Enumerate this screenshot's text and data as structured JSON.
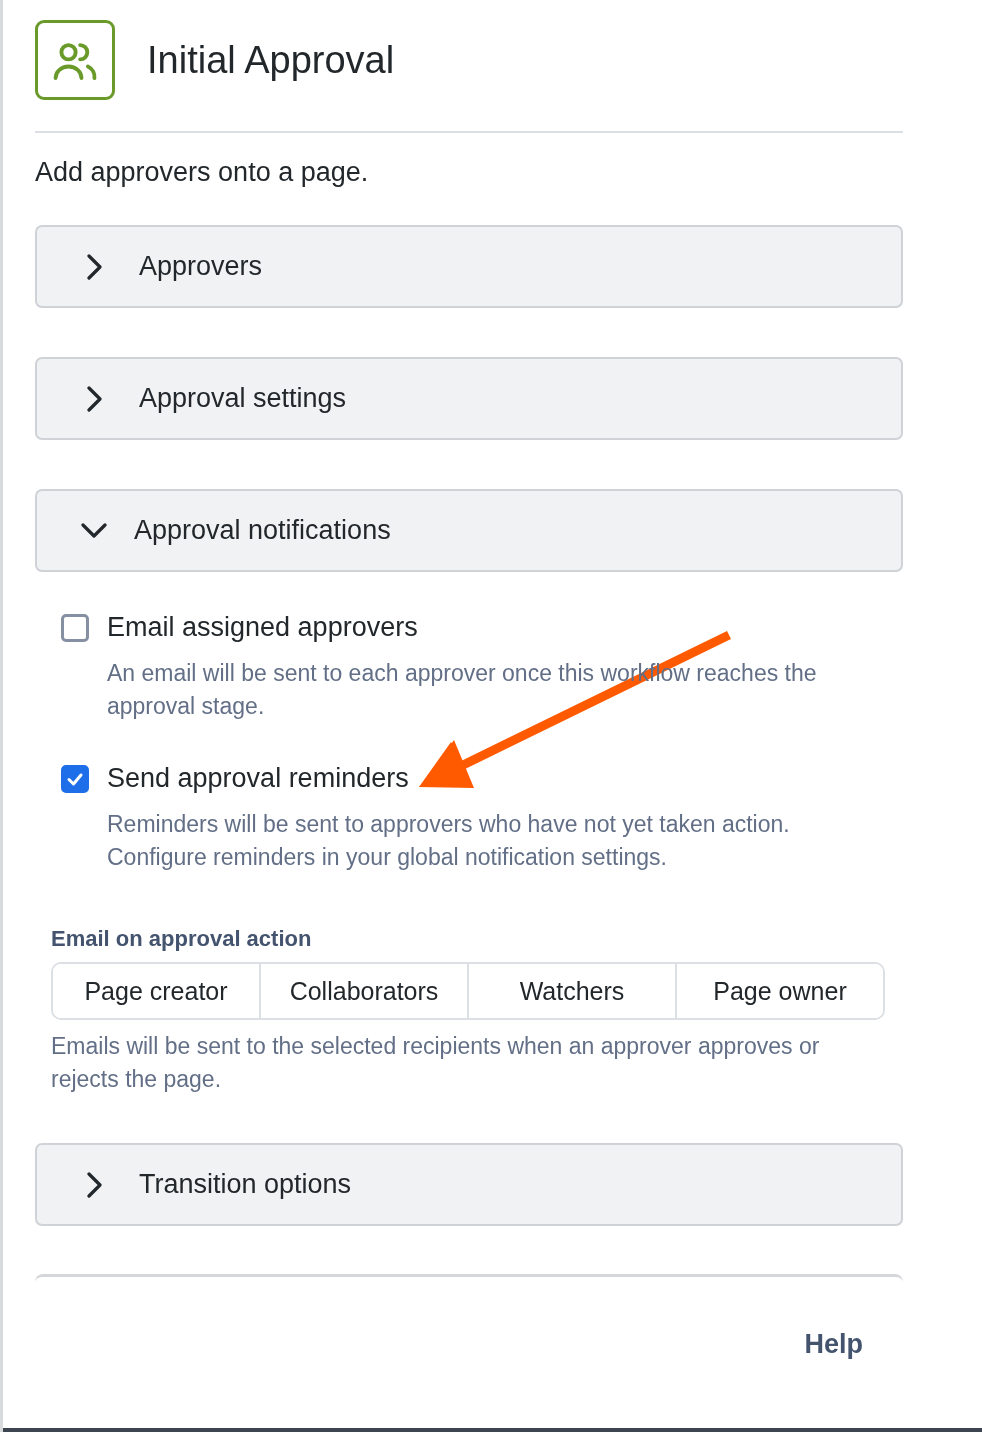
{
  "header": {
    "title": "Initial Approval",
    "description": "Add approvers onto a page."
  },
  "sections": [
    {
      "title": "Approvers",
      "expanded": false
    },
    {
      "title": "Approval settings",
      "expanded": false
    },
    {
      "title": "Approval notifications",
      "expanded": true,
      "options": [
        {
          "label": "Email assigned approvers",
          "checked": false,
          "description": "An email will be sent to each approver once this workflow reaches the approval stage."
        },
        {
          "label": "Send approval reminders",
          "checked": true,
          "description": "Reminders will be sent to approvers who have not yet taken action. Configure reminders in your global notification settings."
        }
      ],
      "recipients": {
        "label": "Email on approval action",
        "buttons": [
          {
            "label": "Page creator",
            "selected": false
          },
          {
            "label": "Collaborators",
            "selected": false
          },
          {
            "label": "Watchers",
            "selected": false
          },
          {
            "label": "Page owner",
            "selected": false
          }
        ],
        "note": "Emails will be sent to the selected recipients when an approver approves or rejects the page."
      }
    },
    {
      "title": "Transition options",
      "expanded": false
    }
  ],
  "footer": {
    "help": "Help"
  }
}
